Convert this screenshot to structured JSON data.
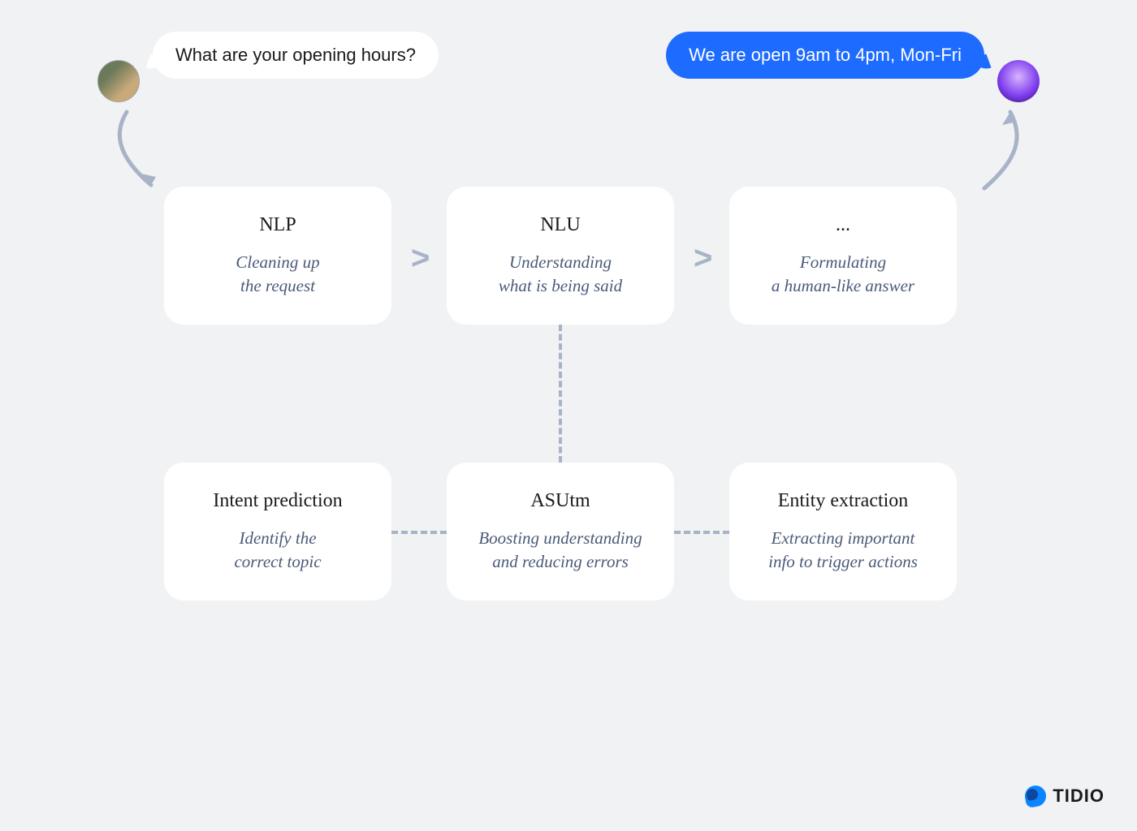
{
  "chat": {
    "user_message": "What are your opening hours?",
    "bot_message": "We are open 9am to 4pm, Mon-Fri"
  },
  "flow": {
    "nlp": {
      "title": "NLP",
      "desc": "Cleaning up\nthe request"
    },
    "nlu": {
      "title": "NLU",
      "desc": "Understanding\nwhat is being said"
    },
    "fmt": {
      "title": "...",
      "desc": "Formulating\na human-like answer"
    },
    "intent": {
      "title": "Intent prediction",
      "desc": "Identify the\ncorrect topic"
    },
    "asutm": {
      "title": "ASUtm",
      "desc": "Boosting understanding\nand reducing errors"
    },
    "entity": {
      "title": "Entity extraction",
      "desc": "Extracting important\ninfo to trigger actions"
    }
  },
  "separators": {
    "chevron": ">"
  },
  "brand": {
    "name": "TIDIO"
  }
}
